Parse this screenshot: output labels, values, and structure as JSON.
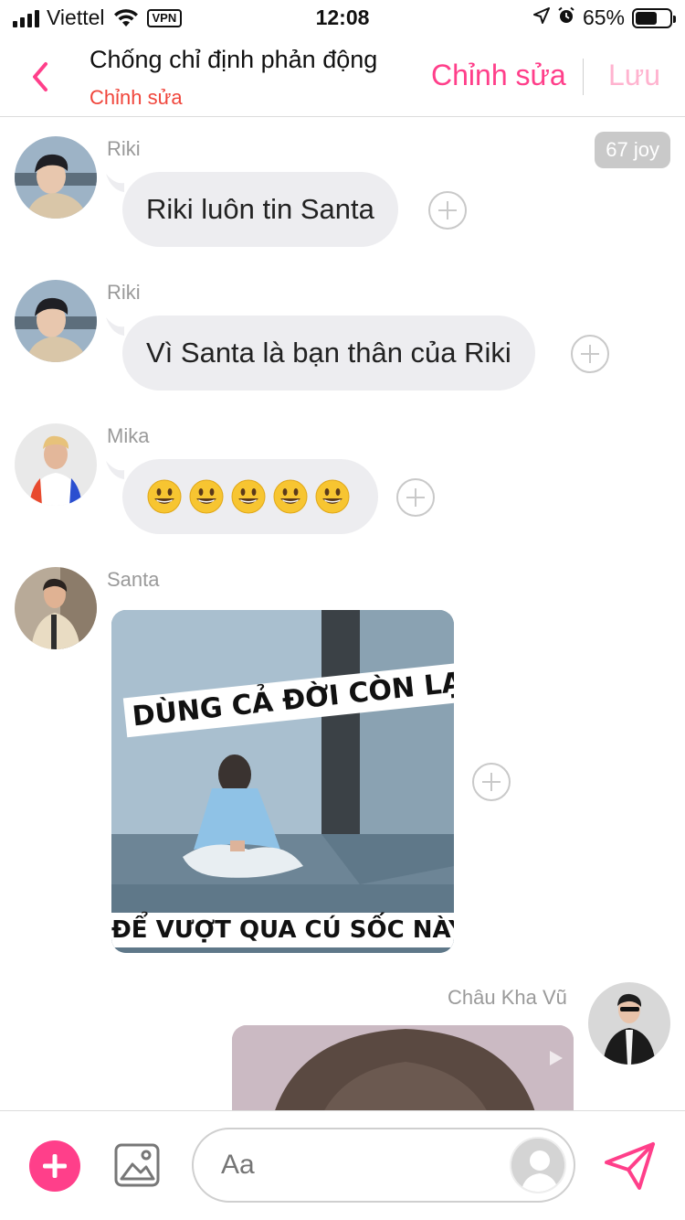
{
  "status_bar": {
    "carrier": "Viettel",
    "vpn": "VPN",
    "time": "12:08",
    "battery_percent": "65%",
    "battery_level": 0.65
  },
  "header": {
    "title": "Chống chỉ định phản động",
    "subtitle": "Chỉnh sửa",
    "edit_label": "Chỉnh sửa",
    "save_label": "Lưu"
  },
  "messages": [
    {
      "sender": "Riki",
      "text": "Riki luôn tin Santa",
      "badge": "67 joy"
    },
    {
      "sender": "Riki",
      "text": "Vì Santa là bạn thân của Riki"
    },
    {
      "sender": "Mika",
      "emoji_count": 5,
      "emoji": "grinning-face"
    },
    {
      "sender": "Santa",
      "image": {
        "caption_top": "DÙNG CẢ ĐỜI CÒN LẠI",
        "caption_bottom": "ĐỂ VƯỢT QUA CÚ SỐC NÀY"
      }
    },
    {
      "sender": "Châu Kha Vũ",
      "outgoing": true
    }
  ],
  "input": {
    "placeholder": "Aa"
  },
  "colors": {
    "accent": "#ff3f8a",
    "accent_light": "#ffb3cf",
    "subtitle_red": "#f0463c",
    "bubble_bg": "#ededf0",
    "badge_bg": "#c9c9c9"
  }
}
